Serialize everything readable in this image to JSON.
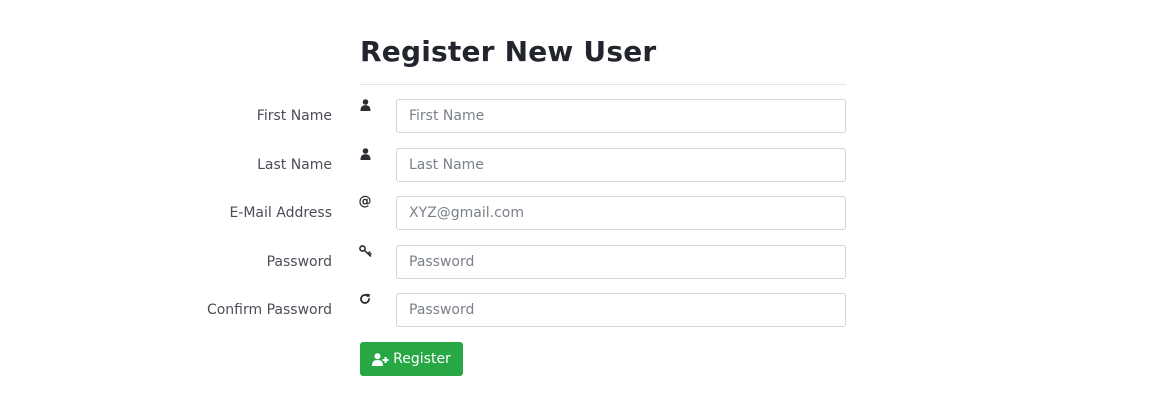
{
  "form": {
    "title": "Register New User",
    "fields": [
      {
        "label": "First Name",
        "icon": "user-icon",
        "placeholder": "First Name",
        "value": ""
      },
      {
        "label": "Last Name",
        "icon": "user-icon",
        "placeholder": "Last Name",
        "value": ""
      },
      {
        "label": "E-Mail Address",
        "icon": "at-icon",
        "icon_glyph": "@",
        "placeholder": "XYZ@gmail.com",
        "value": ""
      },
      {
        "label": "Password",
        "icon": "key-icon",
        "placeholder": "Password",
        "value": ""
      },
      {
        "label": "Confirm Password",
        "icon": "refresh-icon",
        "placeholder": "Password",
        "value": ""
      }
    ],
    "submit": {
      "label": "Register",
      "icon": "user-plus-icon"
    }
  },
  "colors": {
    "button_bg": "#28a745",
    "title_text": "#22252e",
    "input_border": "#ced4da"
  }
}
